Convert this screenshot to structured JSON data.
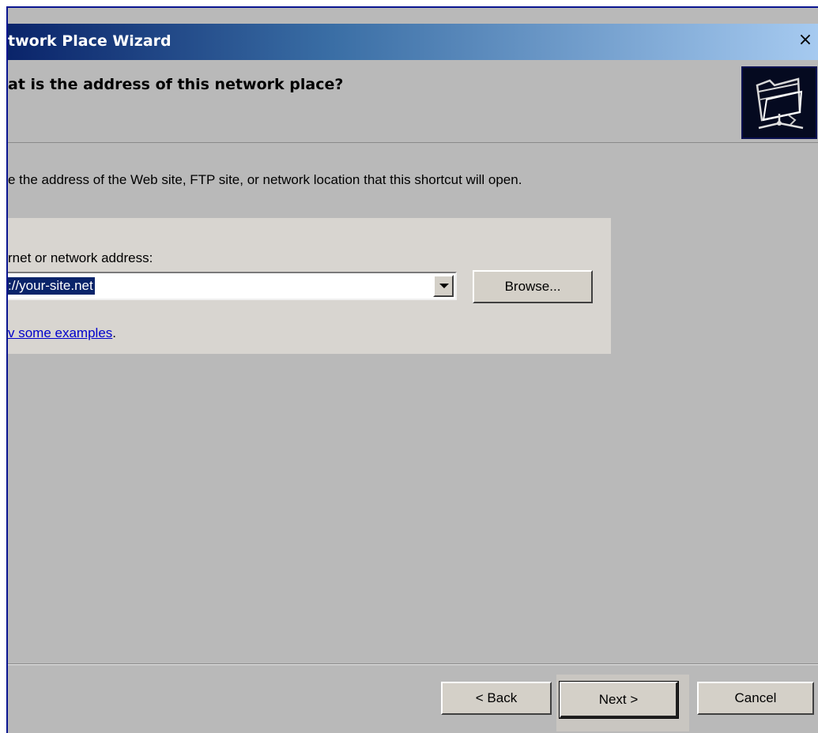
{
  "window": {
    "title": "twork Place Wizard",
    "close_label": "×"
  },
  "header": {
    "title": "at is the address of this network place?",
    "icon": "network-folder-icon"
  },
  "description": "e the address of the Web site, FTP site, or network location that this shortcut will open.",
  "address": {
    "label": "rnet or network address:",
    "value": "://your-site.net",
    "browse_label": "Browse...",
    "examples_link": "v some examples",
    "examples_suffix": "."
  },
  "footer": {
    "back_label": "< Back",
    "next_label": "Next >",
    "cancel_label": "Cancel"
  },
  "colors": {
    "title_gradient_start": "#0a246a",
    "title_gradient_end": "#a6caf0",
    "dialog_bg": "#b9b9b9",
    "panel_bg": "#d8d5d0",
    "selection_bg": "#0a246a",
    "link": "#0000cc"
  }
}
